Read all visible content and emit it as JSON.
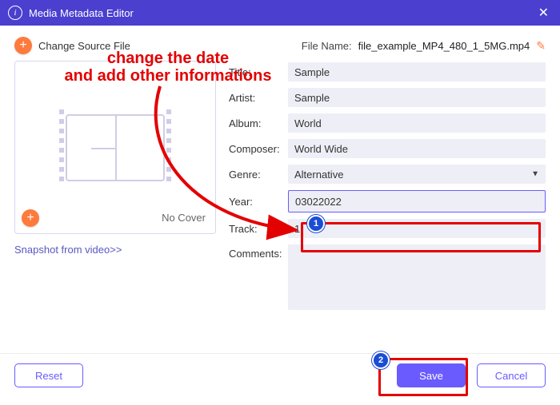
{
  "window": {
    "title": "Media Metadata Editor"
  },
  "top": {
    "change_source": "Change Source File",
    "file_label": "File Name:",
    "file_name": "file_example_MP4_480_1_5MG.mp4"
  },
  "cover": {
    "no_cover": "No Cover",
    "snapshot": "Snapshot from video>>"
  },
  "form": {
    "title_label": "Title:",
    "title_value": "Sample",
    "artist_label": "Artist:",
    "artist_value": "Sample",
    "album_label": "Album:",
    "album_value": "World",
    "composer_label": "Composer:",
    "composer_value": "World Wide",
    "genre_label": "Genre:",
    "genre_value": "Alternative",
    "year_label": "Year:",
    "year_value": "03022022",
    "track_label": "Track:",
    "track_value": "1",
    "comments_label": "Comments:",
    "comments_value": ""
  },
  "footer": {
    "reset": "Reset",
    "save": "Save",
    "cancel": "Cancel"
  },
  "annotation": {
    "line1": "change the date",
    "line2": "and add other informations",
    "badge1": "1",
    "badge2": "2"
  }
}
